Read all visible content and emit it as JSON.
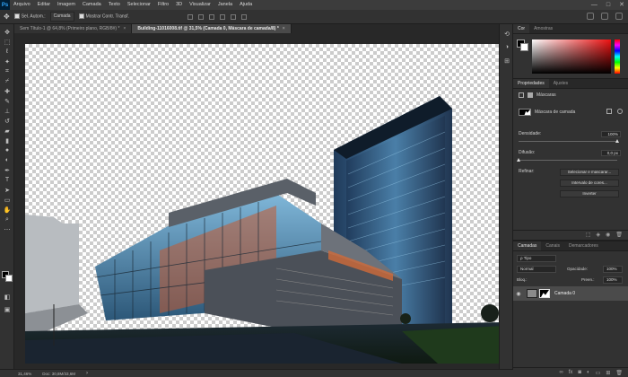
{
  "menu": {
    "logo": "Ps",
    "items": [
      "Arquivo",
      "Editar",
      "Imagem",
      "Camada",
      "Texto",
      "Selecionar",
      "Filtro",
      "3D",
      "Visualizar",
      "Janela",
      "Ajuda"
    ],
    "window_controls": [
      "—",
      "□",
      "✕"
    ]
  },
  "options": {
    "auto_select_label": "Sel. Autom.:",
    "auto_select_value": "Camada",
    "show_transform_label": "Mostrar Contr. Transf."
  },
  "tabs": [
    {
      "label": "Sem Título-1 @ 64,8% (Primeiro plano, RGB/8#) *",
      "close": "×",
      "active": false
    },
    {
      "label": "Building-11016008.tif @ 31,5% (Camada 0, Máscara de camada/8) *",
      "close": "×",
      "active": true
    }
  ],
  "status": {
    "zoom": "31,46%",
    "doc": "Doc: 30,8M/33,6M"
  },
  "color_panel": {
    "tabs": [
      "Cor",
      "Amostras"
    ]
  },
  "properties": {
    "tabs": [
      "Propriedades",
      "Ajustes"
    ],
    "section_label": "Máscaras",
    "mask_label": "Máscara de camada",
    "density_label": "Densidade:",
    "density_value": "100%",
    "feather_label": "Difusão:",
    "feather_value": "0,0 px",
    "refine_label": "Refinar:",
    "btn_select_mask": "Selecionar e mascarar...",
    "btn_color_range": "Intervalo de cores...",
    "btn_invert": "Inverter"
  },
  "layers": {
    "tabs": [
      "Camadas",
      "Canais",
      "Demarcadores"
    ],
    "filter_label": "ρ Tipo",
    "blend_mode": "Normal",
    "opacity_label": "Opacidade:",
    "opacity_value": "100%",
    "lock_label": "Bloq.:",
    "fill_label": "Preen.:",
    "fill_value": "100%",
    "layer_name": "Camada 0"
  }
}
